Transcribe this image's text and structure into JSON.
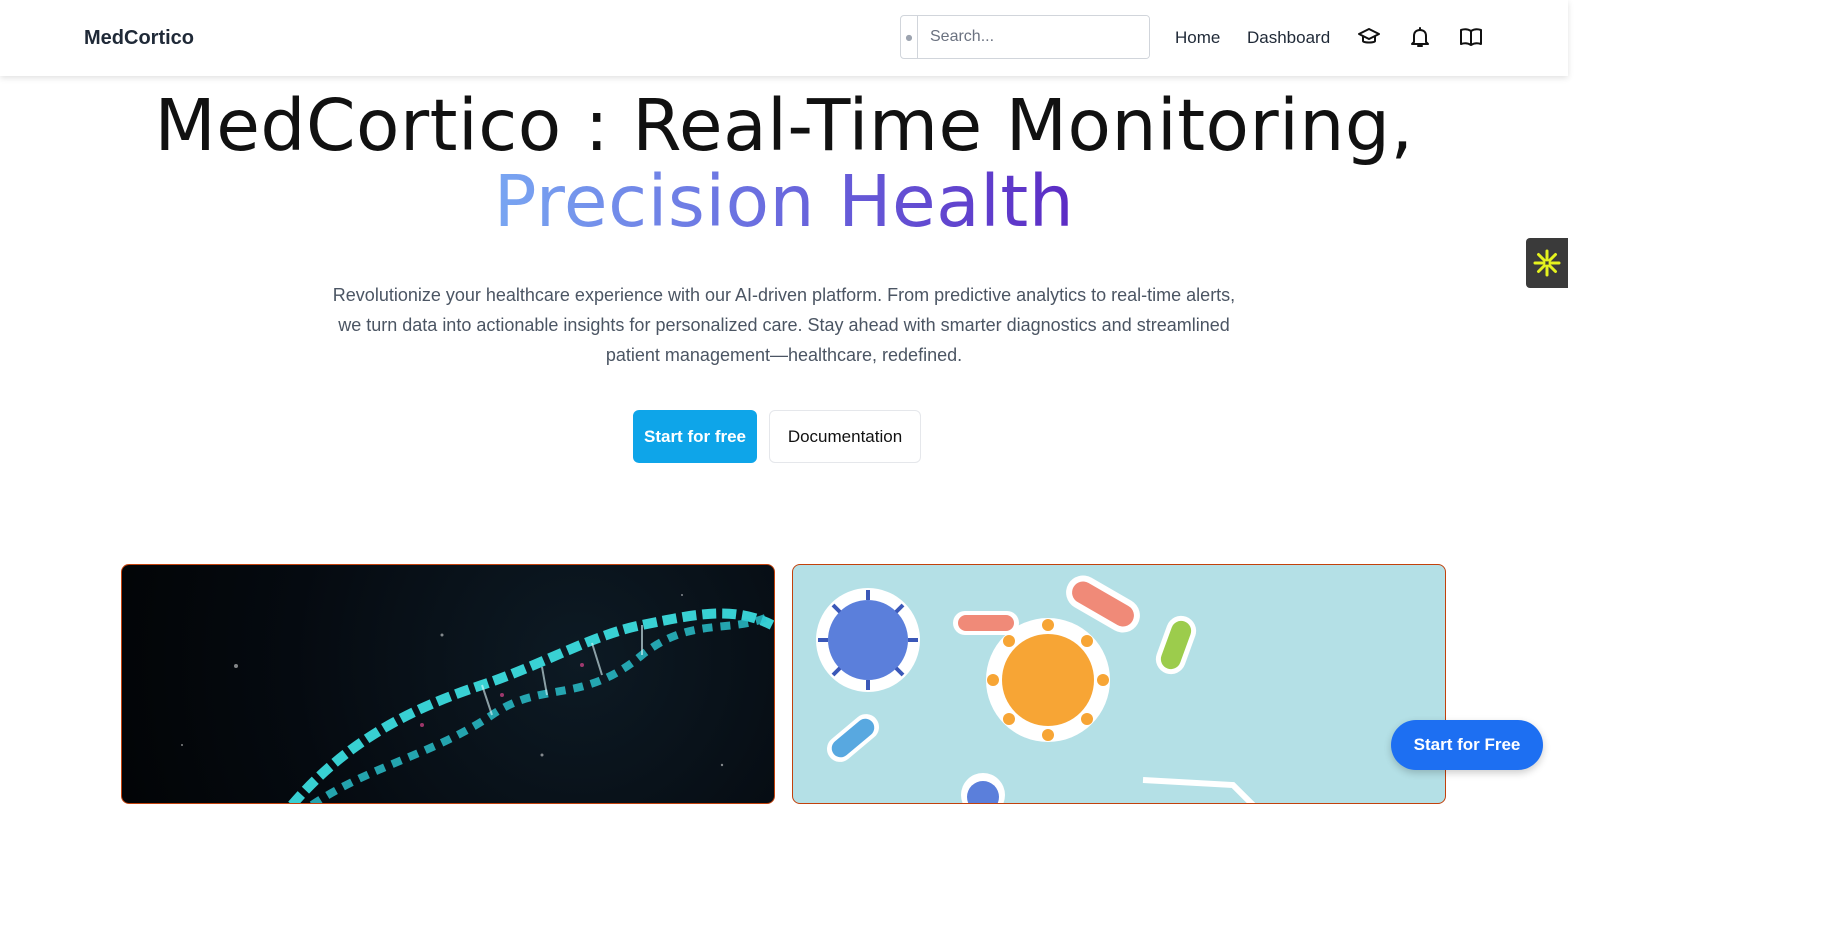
{
  "header": {
    "brand": "MedCortico",
    "search_placeholder": "Search...",
    "nav": {
      "home": "Home",
      "dashboard": "Dashboard"
    },
    "icons": [
      "graduation-cap-icon",
      "bell-icon",
      "book-open-icon"
    ]
  },
  "hero": {
    "title_line1": "MedCortico : Real-Time Monitoring,",
    "title_line2": "Precision Health",
    "subtitle": "Revolutionize your healthcare experience with our AI-driven platform. From predictive analytics to real-time alerts, we turn data into actionable insights for personalized care. Stay ahead with smarter diagnostics and streamlined patient management—healthcare, redefined.",
    "primary_cta": "Start for free",
    "secondary_cta": "Documentation"
  },
  "floating_cta": "Start for Free",
  "colors": {
    "primary": "#0ea5e9",
    "floating": "#1d6ff2",
    "gradient_start": "#79a6f2",
    "gradient_end": "#5b2bc4",
    "card_border": "#c2410c"
  }
}
